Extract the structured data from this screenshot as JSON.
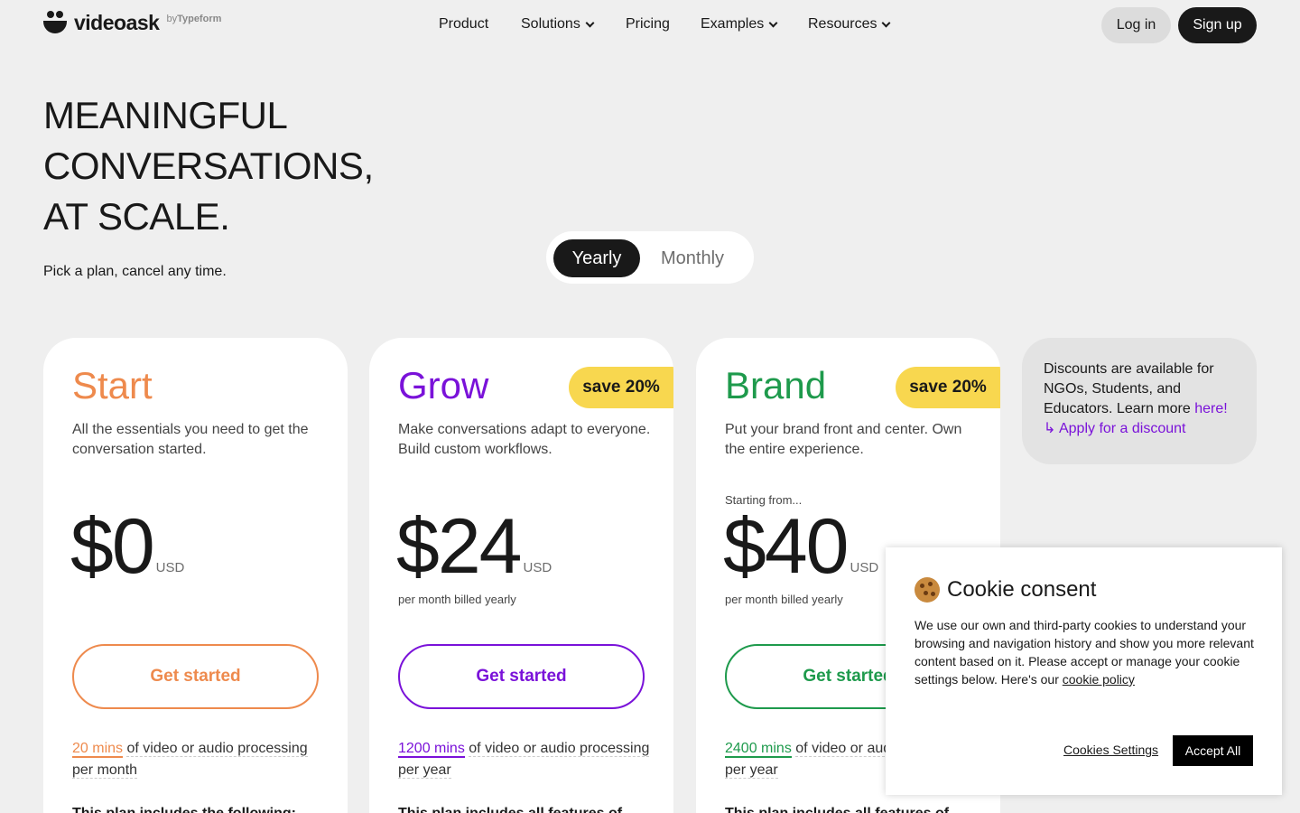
{
  "brand": {
    "name": "videoask",
    "by": "by",
    "by_brand": "Typeform"
  },
  "nav": {
    "items": [
      {
        "label": "Product",
        "dropdown": false
      },
      {
        "label": "Solutions",
        "dropdown": true
      },
      {
        "label": "Pricing",
        "dropdown": false
      },
      {
        "label": "Examples",
        "dropdown": true
      },
      {
        "label": "Resources",
        "dropdown": true
      }
    ],
    "login": "Log in",
    "signup": "Sign up"
  },
  "hero": {
    "title_lines": [
      "MEANINGFUL",
      "CONVERSATIONS,",
      "AT SCALE."
    ],
    "subtitle": "Pick a plan, cancel any time."
  },
  "billing_toggle": {
    "options": [
      "Yearly",
      "Monthly"
    ],
    "selected": "Yearly"
  },
  "plans": [
    {
      "name": "Start",
      "color": "#ee8a4d",
      "badge": "",
      "description": "All the essentials you need to get the conversation started.",
      "starting_from": "",
      "price": "$0",
      "currency": "USD",
      "billing": "",
      "cta": "Get started",
      "minutes": "20 mins",
      "minutes_rest": "of video or audio processing per month",
      "includes": "This plan includes the following:"
    },
    {
      "name": "Grow",
      "color": "#7a12d9",
      "badge": "save 20%",
      "description": "Make conversations adapt to everyone. Build custom workflows.",
      "starting_from": "",
      "price": "$24",
      "currency": "USD",
      "billing": "per month billed yearly",
      "cta": "Get started",
      "minutes": "1200 mins",
      "minutes_rest": "of video or audio processing per year",
      "includes": "This plan includes all features of"
    },
    {
      "name": "Brand",
      "color": "#1e9a4c",
      "badge": "save 20%",
      "description": "Put your brand front and center. Own the entire experience.",
      "starting_from": "Starting from...",
      "price": "$40",
      "currency": "USD",
      "billing": "per month billed yearly",
      "cta": "Get started",
      "minutes": "2400 mins",
      "minutes_rest": "of video or audio processing per year",
      "includes": "This plan includes all features of"
    }
  ],
  "discount": {
    "text": "Discounts are available for NGOs, Students, and Educators. Learn more",
    "learn_link": "here!",
    "apply_link": "↳ Apply for a discount"
  },
  "cookie": {
    "title": "Cookie consent",
    "body": "We use our own and third-party cookies to understand your browsing and navigation history and show you more relevant content based on it. Please accept or manage your cookie settings below. Here's our",
    "policy_link": "cookie policy",
    "settings": "Cookies Settings",
    "accept": "Accept All"
  }
}
